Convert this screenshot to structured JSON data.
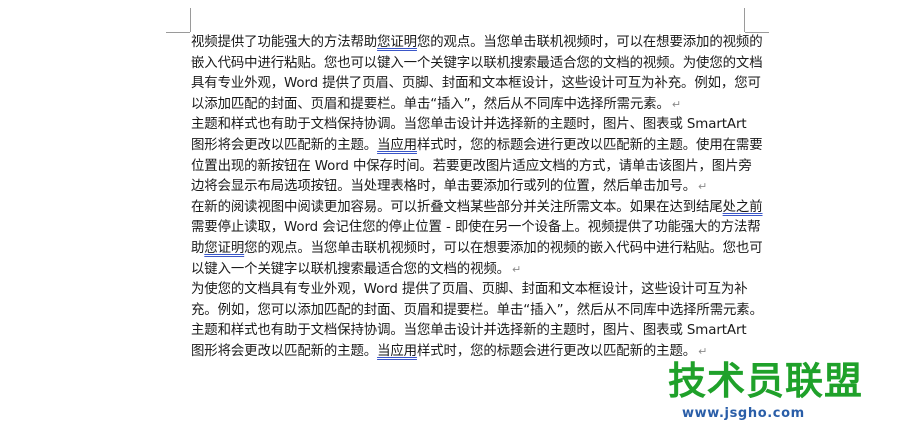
{
  "document": {
    "paragraphs": [
      {
        "segments": [
          {
            "text": "视频提供了功能强大的方法帮助",
            "style": "plain"
          },
          {
            "text": "您证明",
            "style": "squiggle"
          },
          {
            "text": "您的观点。当您单击联机视频时，可以在想要添加的视频的嵌入代码中进行粘贴。您也可以键入一个关键字以联机搜索最适合您的文档的视频。为使您的文档具有专业外观，Word 提供了页眉、页脚、封面和文本框设计，这些设计可互为补充。例如，您可以添加匹配的封面、页眉和提要栏。单击“插入”，然后从不同库中选择所需元素。",
            "style": "plain"
          }
        ]
      },
      {
        "segments": [
          {
            "text": "主题和样式也有助于文档保持协调。当您单击设计并选择新的主题时，图片、图表或 SmartArt 图形将会更改以匹配新的主题。",
            "style": "plain"
          },
          {
            "text": "当应用",
            "style": "squiggle"
          },
          {
            "text": "样式时，您的标题会进行更改以匹配新的主题。使用在需要位置出现的新按钮在 Word 中保存时间。若要更改图片适应文档的方式，请单击该图片，图片旁边将会显示布局选项按钮。当处理表格时，单击要添加行或列的位置，然后单击加号。",
            "style": "plain"
          }
        ]
      },
      {
        "segments": [
          {
            "text": "在新的阅读视图中阅读更加容易。可以折叠文档某些部分并关注所需文本。如果在达到结尾",
            "style": "plain"
          },
          {
            "text": "处之前",
            "style": "squiggle"
          },
          {
            "text": "需要停止读取，Word 会记住您的停止位置 - 即使在另一个设备上。视频提供了功能强大的方法帮助",
            "style": "plain"
          },
          {
            "text": "您证明",
            "style": "squiggle"
          },
          {
            "text": "您的观点。当您单击联机视频时，可以在想要添加的视频的嵌入代码中进行粘贴。您也可以键入一个关键字以联机搜索最适合您的文档的视频。",
            "style": "plain"
          }
        ]
      },
      {
        "segments": [
          {
            "text": "为使您的文档具有专业外观，Word 提供了页眉、页脚、封面和文本框设计，这些设计可互为补充。例如，您可以添加匹配的封面、页眉和提要栏。单击“插入”，然后从不同库中选择所需元素。主题和样式也有助于文档保持协调。当您单击设计并选择新的主题时，图片、图表或 SmartArt 图形将会更改以匹配新的主题。",
            "style": "plain"
          },
          {
            "text": "当应用",
            "style": "squiggle"
          },
          {
            "text": "样式时，您的标题会进行更改以匹配新的主题。",
            "style": "plain"
          }
        ]
      }
    ],
    "paragraph_mark": "↵"
  },
  "watermark": {
    "title": "技术员联盟",
    "url": "www.jsgho.com",
    "colors": {
      "title": "#1fa12a",
      "url": "#2a5ea8"
    }
  },
  "colors": {
    "text": "#1a1a1a",
    "squiggle": "#3a56c8",
    "crop_marks": "#9a9a9a",
    "paragraph_mark": "#8a8a8a"
  }
}
